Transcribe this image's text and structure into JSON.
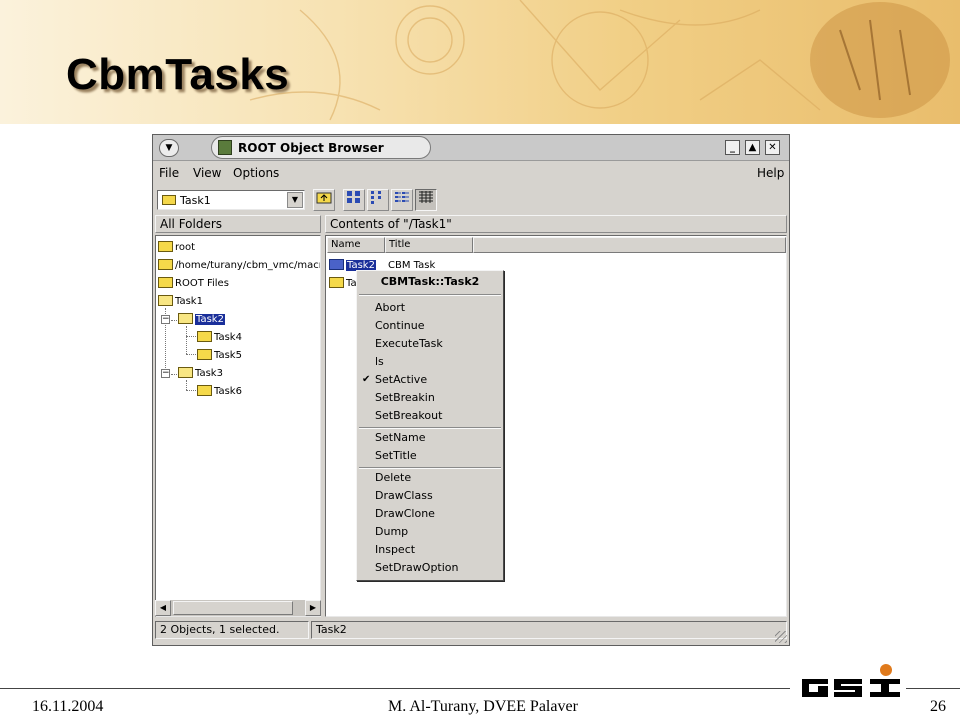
{
  "slide": {
    "title": "CbmTasks",
    "footer_date": "16.11.2004",
    "footer_author": "M. Al-Turany,  DVEE Palaver",
    "footer_page": "26"
  },
  "window": {
    "title": "ROOT Object Browser",
    "buttons": {
      "minimize": "_",
      "maximize": "▲",
      "close": "✕"
    }
  },
  "menubar": {
    "file": "File",
    "view": "View",
    "options": "Options",
    "help": "Help"
  },
  "toolbar": {
    "path_value": "Task1"
  },
  "left_pane": {
    "header": "All Folders",
    "tree": [
      {
        "label": "root",
        "depth": 0
      },
      {
        "label": "/home/turany/cbm_vmc/macro/g",
        "depth": 0
      },
      {
        "label": "ROOT Files",
        "depth": 0
      },
      {
        "label": "Task1",
        "depth": 0
      },
      {
        "label": "Task2",
        "depth": 1,
        "selected": true,
        "open": true
      },
      {
        "label": "Task4",
        "depth": 2
      },
      {
        "label": "Task5",
        "depth": 2
      },
      {
        "label": "Task3",
        "depth": 1
      },
      {
        "label": "Task6",
        "depth": 2
      }
    ]
  },
  "right_pane": {
    "header": "Contents of \"/Task1\"",
    "columns": [
      "Name",
      "Title"
    ],
    "rows": [
      {
        "name": "Task2",
        "title": "CBM Task",
        "selected": true
      },
      {
        "name": "Tas",
        "title": ""
      }
    ]
  },
  "context_menu": {
    "title": "CBMTask::Task2",
    "groups": [
      [
        "Abort",
        "Continue",
        "ExecuteTask",
        "ls",
        "SetActive",
        "SetBreakin",
        "SetBreakout"
      ],
      [
        "SetName",
        "SetTitle"
      ],
      [
        "Delete",
        "DrawClass",
        "DrawClone",
        "Dump",
        "Inspect",
        "SetDrawOption"
      ]
    ],
    "checked_item": "SetActive"
  },
  "statusbar": {
    "left": "2 Objects, 1 selected.",
    "right": "Task2"
  },
  "colors": {
    "selection": "#1a2f9a",
    "folder": "#f5d94a",
    "window_bg": "#d6d3ce"
  },
  "logo": "GSI"
}
